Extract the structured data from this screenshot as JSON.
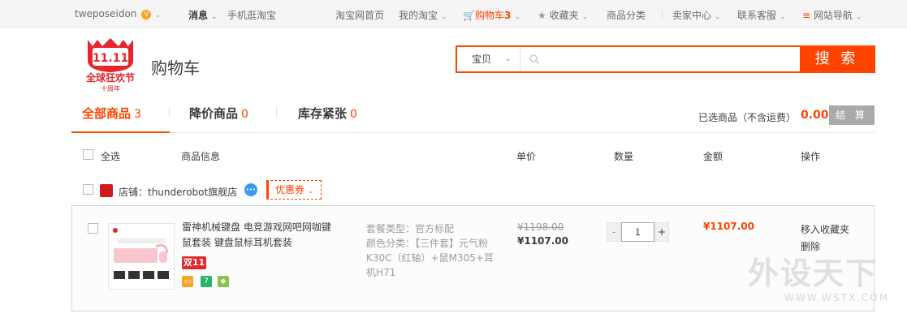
{
  "topbar": {
    "username": "tweposeidon",
    "messages": "消息",
    "mobile": "手机逛淘宝",
    "home": "淘宝网首页",
    "my_taobao": "我的淘宝",
    "cart_label": "购物车",
    "cart_count": "3",
    "favorites": "收藏夹",
    "categories": "商品分类",
    "seller_center": "卖家中心",
    "contact": "联系客服",
    "site_nav": "网站导航"
  },
  "header": {
    "logo_caption": "全球狂欢节",
    "logo_sub": "十周年",
    "logo_mark": "11.11",
    "title": "购物车"
  },
  "search": {
    "category": "宝贝",
    "placeholder": "",
    "button": "搜 索"
  },
  "tabs": [
    {
      "label": "全部商品",
      "count": "3"
    },
    {
      "label": "降价商品",
      "count": "0"
    },
    {
      "label": "库存紧张",
      "count": "0"
    }
  ],
  "summary": {
    "selected_label": "已选商品（不含运费）",
    "total": "0.00",
    "settle_button": "结 算"
  },
  "columns": {
    "select_all": "全选",
    "info": "商品信息",
    "unit_price": "单价",
    "quantity": "数量",
    "amount": "金额",
    "actions": "操作"
  },
  "shop": {
    "name": "店铺：thunderobot旗舰店",
    "coupon": "优惠券"
  },
  "item": {
    "title": "雷神机械键盘 电竞游戏网吧网咖键鼠套装 键盘鼠标耳机套装",
    "badge": "双11",
    "props": [
      "套餐类型：官方标配",
      "颜色分类：【三件套】元气粉K30C（红轴）+鼠M305+耳机H71"
    ],
    "old_price": "¥1198.00",
    "price": "¥1107.00",
    "quantity": "1",
    "minus": "-",
    "plus": "+",
    "amount": "¥1107.00",
    "actions": [
      "移入收藏夹",
      "删除"
    ]
  },
  "watermark": {
    "main": "外设天下",
    "url": "WWW.WSTX.COM"
  },
  "colors": {
    "accent": "#ff4400",
    "badge_red": "#e5262d"
  }
}
